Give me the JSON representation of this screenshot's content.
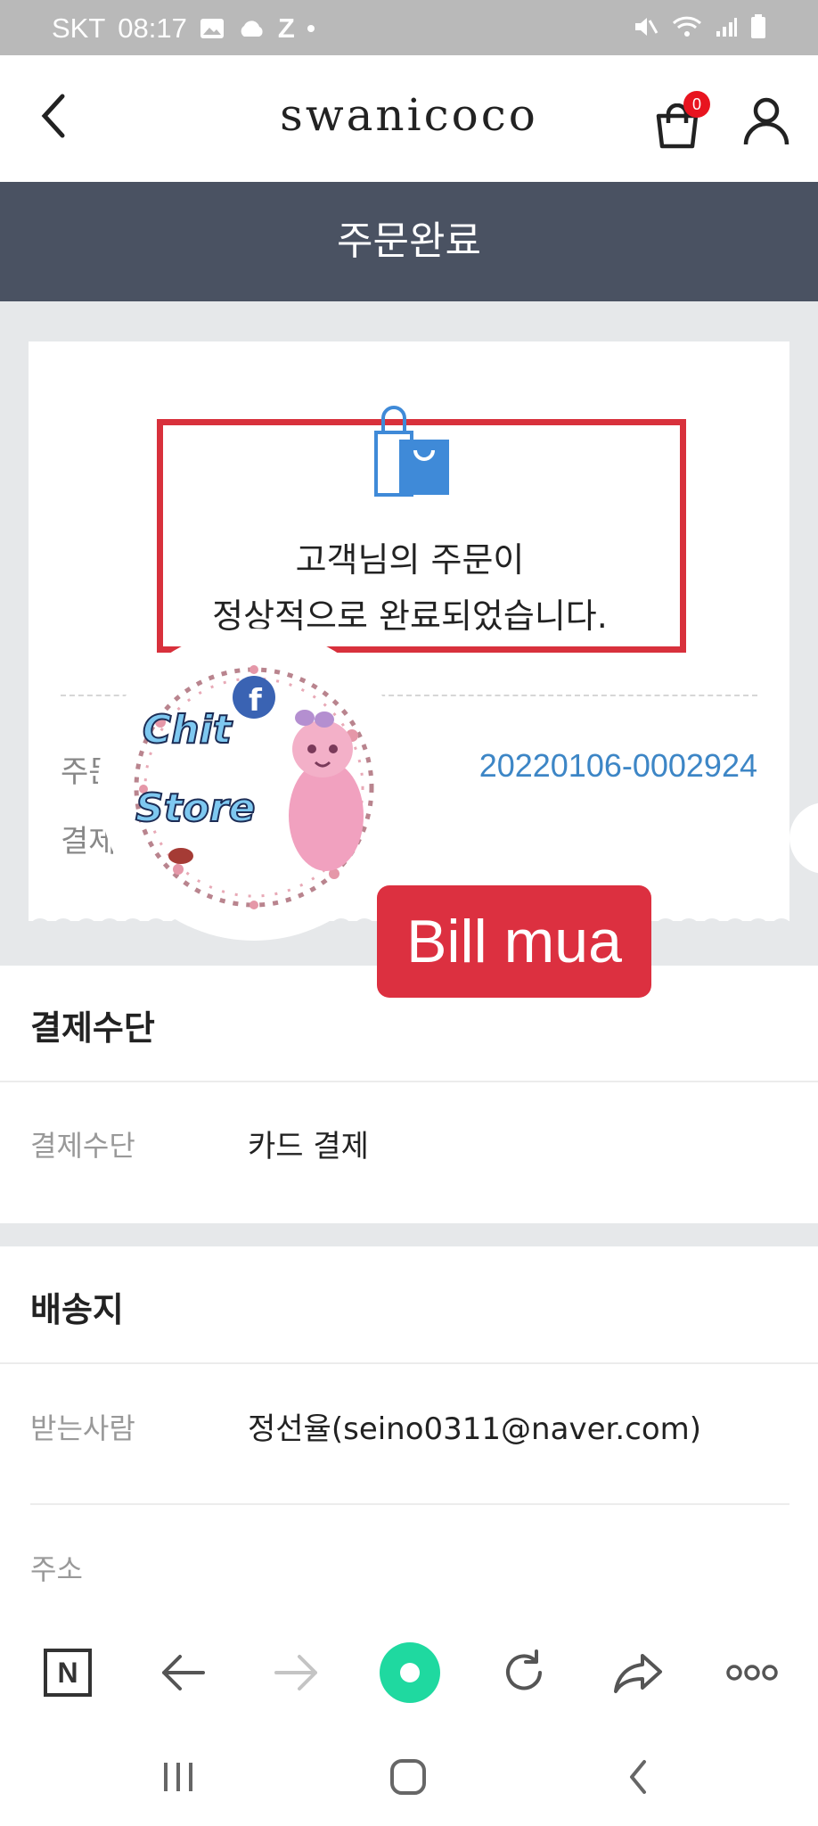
{
  "status_bar": {
    "carrier": "SKT",
    "time": "08:17",
    "z_label": "Z"
  },
  "header": {
    "brand": "swanicoco",
    "cart_count": "0"
  },
  "page_title": "주문완료",
  "completion": {
    "message_line1": "고객님의 주문이",
    "message_line2": "정상적으로 완료되었습니다.",
    "order_label": "주문번호",
    "order_number": "20220106-0002924",
    "payment_label": "결제금액"
  },
  "watermark": {
    "line1": "Chit",
    "line2": "Store"
  },
  "badge": {
    "text": "Bill mua"
  },
  "payment_section": {
    "title": "결제수단",
    "method_label": "결제수단",
    "method_value": "카드 결제"
  },
  "shipping_section": {
    "title": "배송지",
    "recipient_label": "받는사람",
    "recipient_value": "정선율(seino0311@naver.com)",
    "address_label": "주소"
  },
  "browser_toolbar": {
    "n_label": "N"
  },
  "colors": {
    "header_bar": "#4a5262",
    "accent_red": "#dc3040",
    "link_blue": "#3d86c6",
    "cart_badge": "#e8141f"
  }
}
